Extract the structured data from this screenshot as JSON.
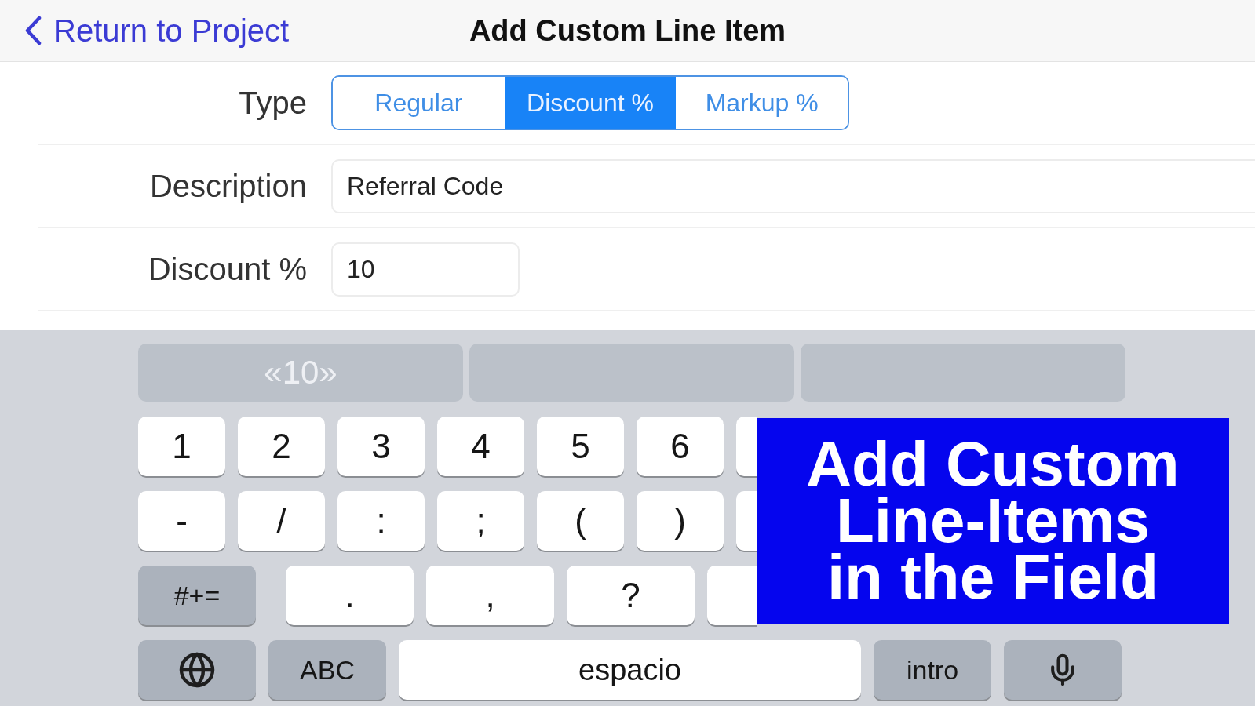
{
  "nav_bar": {
    "back_label": "Return to Project",
    "title": "Add Custom Line Item"
  },
  "form": {
    "rows": [
      {
        "kind": "segmented",
        "label": "Type",
        "segments": [
          {
            "label": "Regular",
            "selected": false
          },
          {
            "label": "Discount %",
            "selected": true
          },
          {
            "label": "Markup %",
            "selected": false
          }
        ]
      },
      {
        "kind": "text",
        "label": "Description",
        "value": "Referral Code"
      },
      {
        "kind": "number",
        "label": "Discount %",
        "value": "10"
      }
    ]
  },
  "keyboard": {
    "suggestions": [
      "«10»"
    ],
    "rows": [
      {
        "keys": [
          {
            "kind": "char",
            "label": "1"
          },
          {
            "kind": "char",
            "label": "2"
          },
          {
            "kind": "char",
            "label": "3"
          },
          {
            "kind": "char",
            "label": "4"
          },
          {
            "kind": "char",
            "label": "5"
          },
          {
            "kind": "char",
            "label": "6"
          },
          {
            "kind": "covered"
          }
        ]
      },
      {
        "keys": [
          {
            "kind": "char",
            "label": "-"
          },
          {
            "kind": "char",
            "label": "/"
          },
          {
            "kind": "char",
            "label": ":"
          },
          {
            "kind": "char",
            "label": ";"
          },
          {
            "kind": "char",
            "label": "("
          },
          {
            "kind": "char",
            "label": ")"
          },
          {
            "kind": "covered"
          }
        ]
      },
      {
        "keys": [
          {
            "kind": "modifier",
            "label": "#+="
          },
          {
            "kind": "char",
            "label": "."
          },
          {
            "kind": "char",
            "label": ","
          },
          {
            "kind": "char",
            "label": "?"
          },
          {
            "kind": "covered"
          }
        ]
      },
      {
        "keys": [
          {
            "kind": "globe"
          },
          {
            "kind": "modifier",
            "label": "ABC"
          },
          {
            "kind": "space",
            "label": "espacio"
          },
          {
            "kind": "modifier",
            "label": "intro"
          },
          {
            "kind": "mic"
          }
        ]
      }
    ]
  },
  "caption_banner": {
    "text": "Add Custom\nLine-Items\nin the Field"
  }
}
